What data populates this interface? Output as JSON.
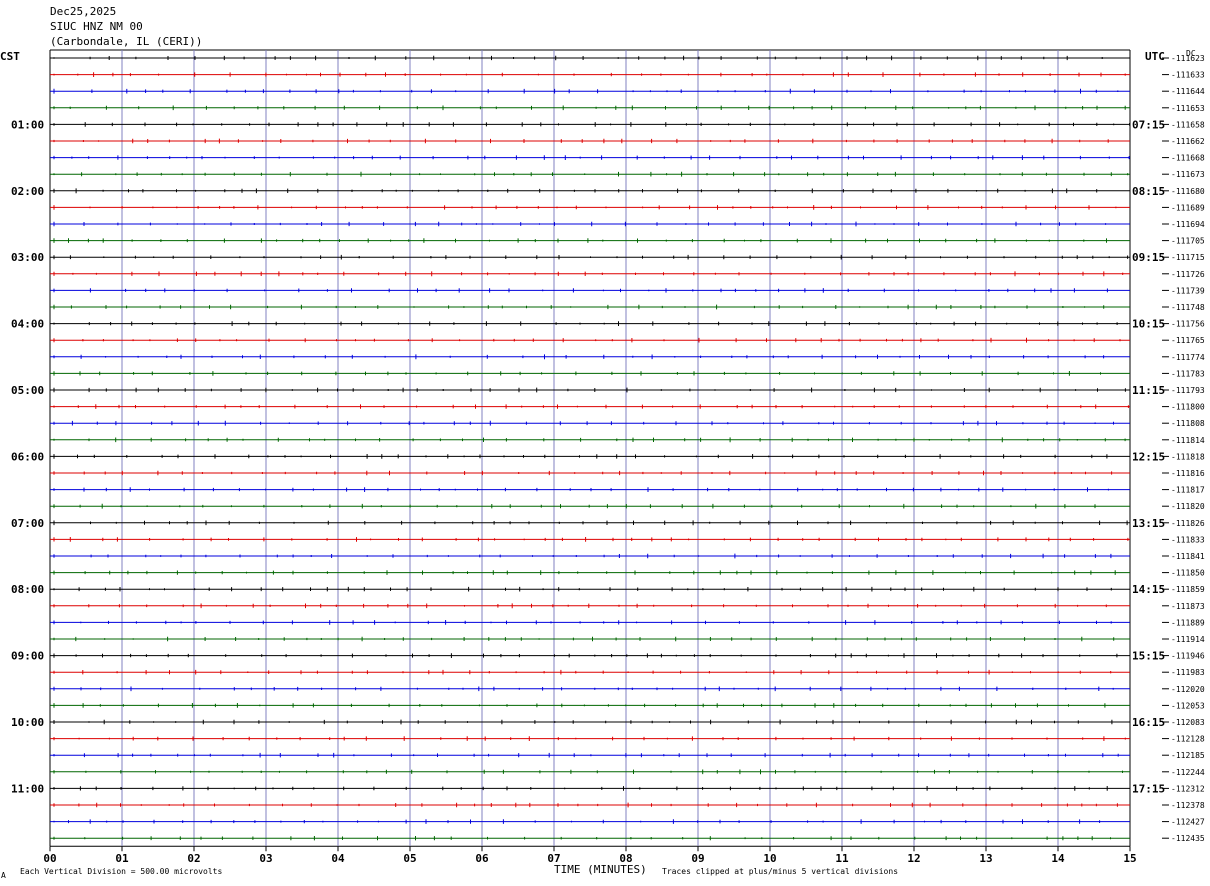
{
  "header": {
    "date": "Dec25,2025",
    "station": "SIUC HNZ NM 00",
    "location": "(Carbondale, IL (CERI))"
  },
  "left_timezone": "CST",
  "right_timezone": "UTC",
  "dc_label": "DC",
  "footer": {
    "division_note": "Each Vertical Division =  500.00 microvolts",
    "x_axis_label": "TIME (MINUTES)",
    "clip_note": "Traces clipped at plus/minus 5 vertical divisions",
    "corner_mark": "A"
  },
  "colors": {
    "trace_cycle": [
      "#000000",
      "#dd0000",
      "#0000dd",
      "#006600"
    ],
    "grid_vertical": "#8080c0"
  },
  "chart_data": {
    "type": "helicorder",
    "xlabel": "TIME (MINUTES)",
    "x_ticks": [
      "00",
      "01",
      "02",
      "03",
      "04",
      "05",
      "06",
      "07",
      "08",
      "09",
      "10",
      "11",
      "12",
      "13",
      "14",
      "15"
    ],
    "xlim": [
      0,
      15
    ],
    "left_hour_labels": [
      "01:00",
      "02:00",
      "03:00",
      "04:00",
      "05:00",
      "06:00",
      "07:00",
      "08:00",
      "09:00",
      "10:00",
      "11:00"
    ],
    "right_hour_labels": [
      "07:15",
      "08:15",
      "09:15",
      "10:15",
      "11:15",
      "12:15",
      "13:15",
      "14:15",
      "15:15",
      "16:15",
      "17:15"
    ],
    "dc_offsets": [
      "-111623",
      "-111633",
      "-111644",
      "-111653",
      "-111658",
      "-111662",
      "-111668",
      "-111673",
      "-111680",
      "-111689",
      "-111694",
      "-111705",
      "-111715",
      "-111726",
      "-111739",
      "-111748",
      "-111756",
      "-111765",
      "-111774",
      "-111783",
      "-111793",
      "-111800",
      "-111808",
      "-111814",
      "-111818",
      "-111816",
      "-111817",
      "-111820",
      "-111826",
      "-111833",
      "-111841",
      "-111850",
      "-111859",
      "-111873",
      "-111889",
      "-111914",
      "-111946",
      "-111983",
      "-112020",
      "-112053",
      "-112083",
      "-112128",
      "-112185",
      "-112244",
      "-112312",
      "-112378",
      "-112427",
      "-112435"
    ]
  }
}
